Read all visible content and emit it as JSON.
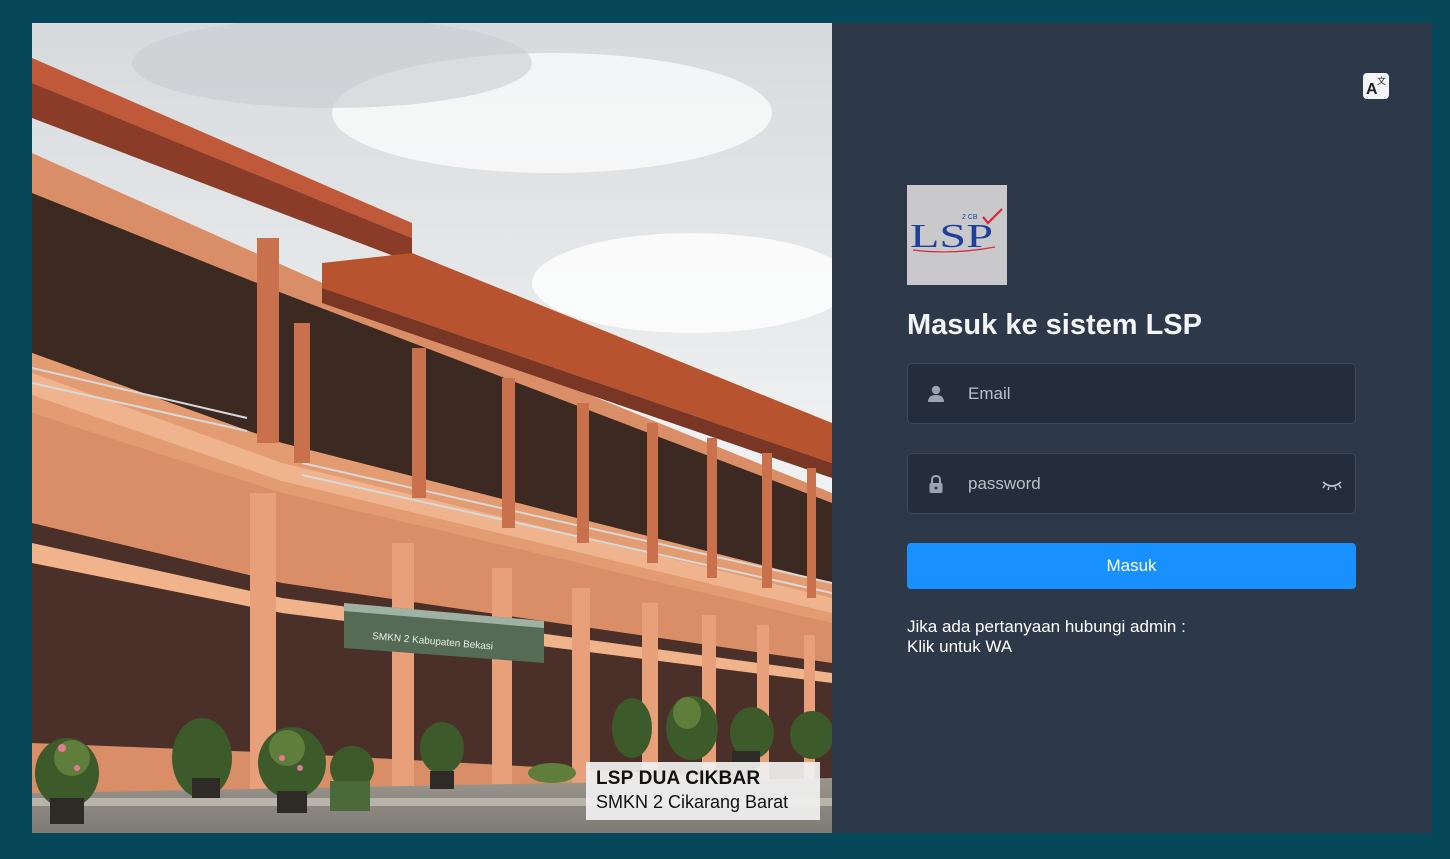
{
  "photo": {
    "caption_title": "LSP DUA CIKBAR",
    "caption_subtitle": "SMKN 2 Cikarang Barat",
    "banner_text": "SMKN 2 Kabupaten Bekasi"
  },
  "logo": {
    "main_text": "LSP",
    "small_text": "2 CB"
  },
  "header": {
    "language_icon": "translate-icon"
  },
  "login": {
    "title": "Masuk ke sistem LSP",
    "email_placeholder": "Email",
    "password_placeholder": "password",
    "submit_label": "Masuk"
  },
  "help": {
    "question_text": "Jika ada pertanyaan hubungi admin :",
    "wa_link_text": "Klik untuk WA"
  },
  "colors": {
    "page_background": "#07475a",
    "panel_background": "#2d3848",
    "input_background": "#232d3b",
    "primary_button": "#1890ff"
  }
}
